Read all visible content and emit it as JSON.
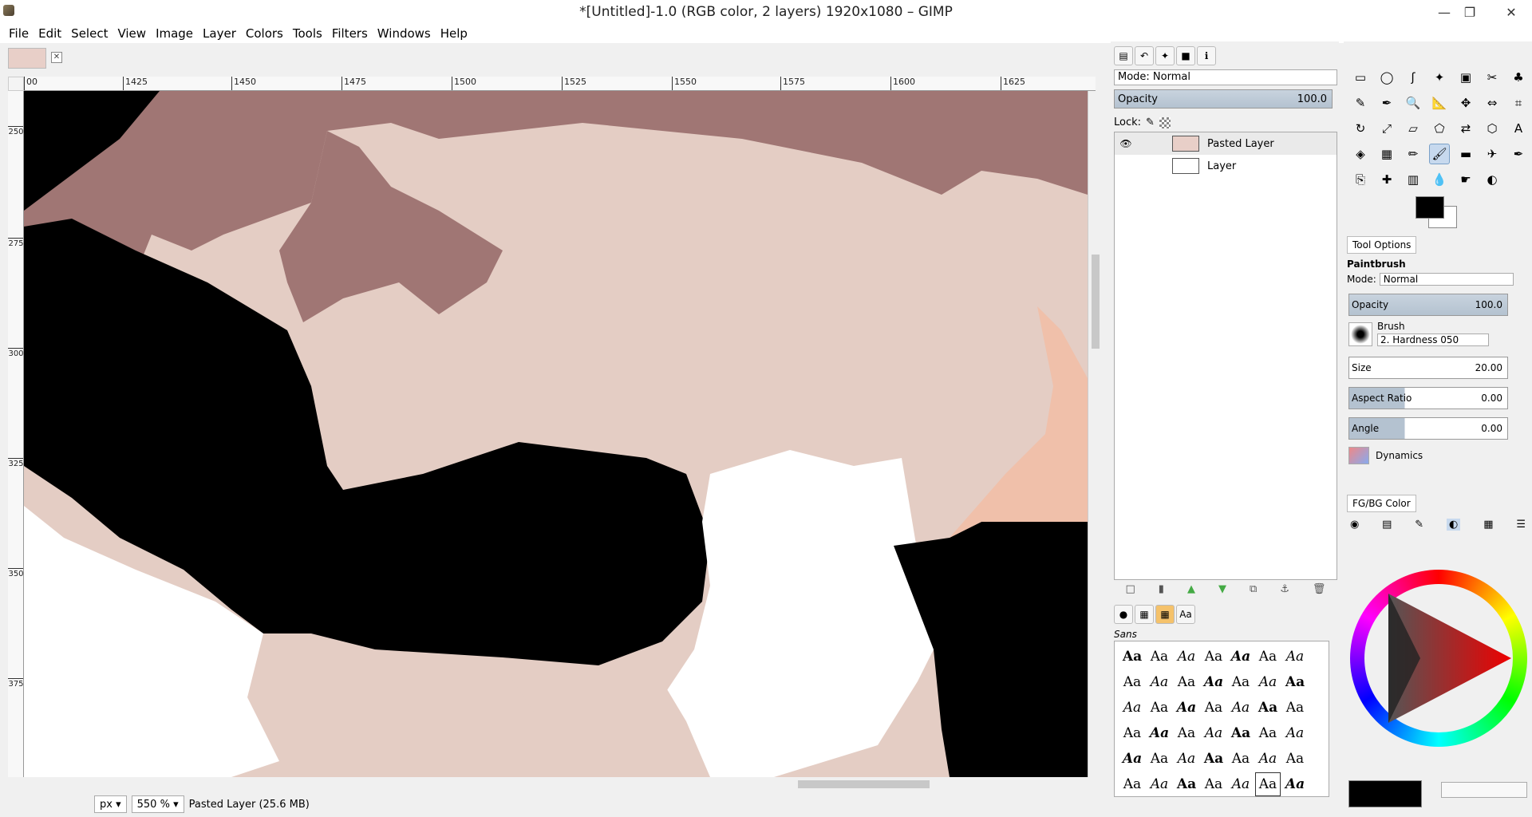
{
  "window": {
    "title": "*[Untitled]-1.0 (RGB color, 2 layers) 1920x1080 – GIMP"
  },
  "menu": [
    "File",
    "Edit",
    "Select",
    "View",
    "Image",
    "Layer",
    "Colors",
    "Tools",
    "Filters",
    "Windows",
    "Help"
  ],
  "ruler": {
    "h_ticks": [
      "00",
      "1425",
      "1450",
      "1475",
      "1500",
      "1525",
      "1550",
      "1575",
      "1600",
      "1625"
    ],
    "v_ticks": [
      "250",
      "275",
      "300",
      "325",
      "350",
      "375"
    ]
  },
  "status": {
    "unit": "px",
    "zoom": "550 %",
    "message": "Pasted Layer (25.6 MB)"
  },
  "layers": {
    "mode_label": "Mode: Normal",
    "opacity_label": "Opacity",
    "opacity_value": "100.0",
    "lock_label": "Lock:",
    "items": [
      {
        "name": "Pasted Layer",
        "visible": true
      },
      {
        "name": "Layer",
        "visible": false
      }
    ]
  },
  "fonts": {
    "category": "Sans",
    "sample": "Aa"
  },
  "tool_options": {
    "tab_label": "Tool Options",
    "tool_name": "Paintbrush",
    "mode_label": "Mode:",
    "mode_value": "Normal",
    "opacity_label": "Opacity",
    "opacity_value": "100.0",
    "brush_label": "Brush",
    "brush_value": "2. Hardness 050",
    "size_label": "Size",
    "size_value": "20.00",
    "aspect_label": "Aspect Ratio",
    "aspect_value": "0.00",
    "angle_label": "Angle",
    "angle_value": "0.00",
    "dynamics_label": "Dynamics"
  },
  "fgbg": {
    "tab_label": "FG/BG Color"
  },
  "colors": {
    "fg": "#000000",
    "bg": "#ffffff",
    "accent": "#c7d9ee"
  }
}
